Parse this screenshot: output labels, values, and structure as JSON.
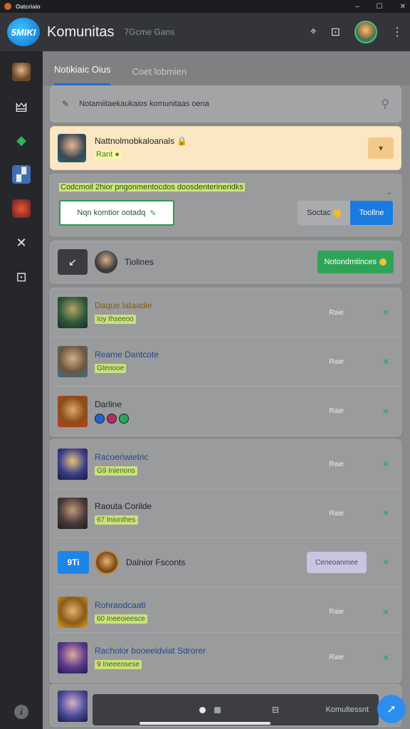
{
  "window": {
    "title": "Oatcriaio"
  },
  "header": {
    "app_title": "Komunitas",
    "subtitle": "7Gcme Gans",
    "logo_text": "5MIKI"
  },
  "tabs": [
    {
      "label": "Notikiaic Oius",
      "active": true
    },
    {
      "label": "Coet lobmien",
      "active": false
    }
  ],
  "search": {
    "text": "Notamiitaekaukaios komunitaas oena"
  },
  "notice": {
    "title": "Nattnolmobkaloanals",
    "subtitle": "Rant"
  },
  "invite": {
    "text": "Codcmoil 2hior pngonmentocdos doosdenterineridks",
    "button_label": "Nqn komtior ootadq",
    "seg_a_label": "Soctac",
    "seg_b_label": "Toollne"
  },
  "online": {
    "label": "Tiolines",
    "button_label": "Notondmtinces"
  },
  "groups": [
    {
      "rows": [
        {
          "title": "Daque lataadie",
          "subtitle": "Ioy Ihseeoo",
          "right": "Raie",
          "title_color": "#8a5a10"
        },
        {
          "title": "Reame Dantcote",
          "subtitle": "Gtenooe",
          "right": "Raie",
          "title_color": "#1f4a8a"
        },
        {
          "title": "Darline",
          "subtitle": "",
          "right": "Raie",
          "title_color": "#1f2124",
          "badges": true
        }
      ]
    },
    {
      "rows": [
        {
          "title": "Racoeriwietric",
          "subtitle": "G9 Inienons",
          "right": "Raie",
          "title_color": "#1f4a8a"
        },
        {
          "title": "Raouta Corilde",
          "subtitle": "67 Inionthes",
          "right": "Raie",
          "title_color": "#1f2124"
        },
        {
          "title": "Dalnior Fsconts",
          "chip": "9Ti",
          "button_label": "Ceneoanmee",
          "title_color": "#1f2124",
          "special": true
        },
        {
          "title": "Rohraodcaati",
          "subtitle": "60 Ineeoieesce",
          "right": "Raie",
          "title_color": "#1f4a8a"
        }
      ]
    },
    {
      "rows": [
        {
          "title": "Racholor booeeidviat Sdrorer",
          "subtitle": "Ineeeosese",
          "subtitle_prefix": "9",
          "right": "Raie",
          "title_color": "#1f4a8a"
        }
      ]
    }
  ],
  "bottom_bar": {
    "label": "Komultessnt"
  },
  "colors": {
    "accent": "#1f6fcf",
    "success": "#2ea556",
    "notice_bg": "#fbe7c3"
  }
}
